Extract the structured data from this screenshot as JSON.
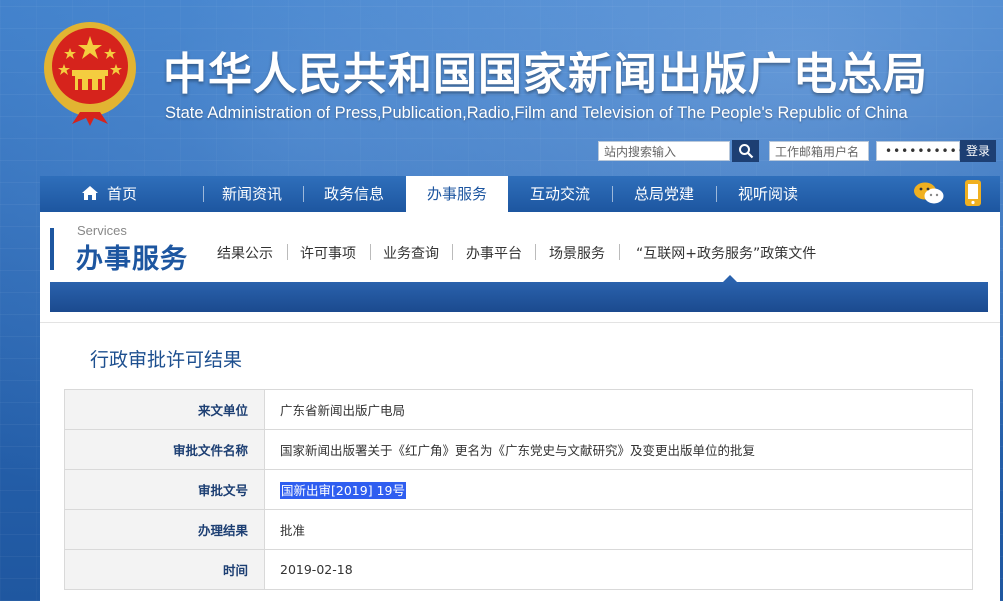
{
  "header": {
    "title_cn": "中华人民共和国国家新闻出版广电总局",
    "title_en": "State Administration of Press,Publication,Radio,Film and Television of The People's Republic of China"
  },
  "toolbar": {
    "search_placeholder": "站内搜索输入",
    "user_placeholder": "工作邮箱用户名",
    "password_mask": "••••••••••",
    "login_label": "登录"
  },
  "nav": {
    "items": [
      {
        "label": "首页"
      },
      {
        "label": "新闻资讯"
      },
      {
        "label": "政务信息"
      },
      {
        "label": "办事服务"
      },
      {
        "label": "互动交流"
      },
      {
        "label": "总局党建"
      },
      {
        "label": "视听阅读"
      }
    ],
    "active_index": 3
  },
  "services": {
    "title_en": "Services",
    "title_cn": "办事服务",
    "subnav": [
      "结果公示",
      "许可事项",
      "业务查询",
      "办事平台",
      "场景服务",
      "“互联网+政务服务”政策文件"
    ]
  },
  "page": {
    "title": "行政审批许可结果"
  },
  "record": {
    "rows": [
      {
        "key": "来文单位",
        "value": "广东省新闻出版广电局"
      },
      {
        "key": "审批文件名称",
        "value": "国家新闻出版署关于《红广角》更名为《广东党史与文献研究》及变更出版单位的批复"
      },
      {
        "key": "审批文号",
        "value": "国新出审[2019] 19号"
      },
      {
        "key": "办理结果",
        "value": "批准"
      },
      {
        "key": "时间",
        "value": "2019-02-18"
      }
    ]
  },
  "colors": {
    "brand_blue": "#1d56a0",
    "header_bg": "#2a67b3",
    "selection": "#2f5ef0"
  }
}
